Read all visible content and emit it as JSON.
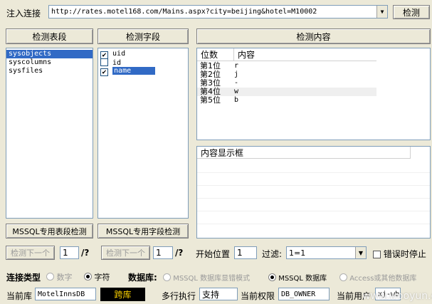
{
  "top": {
    "inject_label": "注入连接",
    "url": "http://rates.motel168.com/Mains.aspx?city=beijing&hotel=M10002",
    "detect_button": "检测"
  },
  "tables_panel": {
    "header": "检测表段",
    "items": [
      "sysobjects",
      "syscolumns",
      "sysfiles"
    ],
    "selected_index": 0,
    "button": "MSSQL专用表段检测"
  },
  "fields_panel": {
    "header": "检测字段",
    "items": [
      {
        "label": "uid",
        "checked": "✔"
      },
      {
        "label": "id",
        "checked": ""
      },
      {
        "label": "name",
        "checked": "✔"
      }
    ],
    "button": "MSSQL专用字段检测"
  },
  "content_panel": {
    "header": "检测内容",
    "columns": [
      "位数",
      "内容"
    ],
    "rows": [
      {
        "pos": "第1位",
        "val": "r"
      },
      {
        "pos": "第2位",
        "val": "j"
      },
      {
        "pos": "第3位",
        "val": "-"
      },
      {
        "pos": "第4位",
        "val": "w"
      },
      {
        "pos": "第5位",
        "val": "b"
      }
    ],
    "display_header": "内容显示框"
  },
  "nav": {
    "next1": "检测下一个",
    "page1": "1",
    "q1": "/?",
    "next2": "检测下一个",
    "page2": "1",
    "q2": "/?",
    "start_label": "开始位置",
    "start_value": "1",
    "filter_label": "过滤:",
    "filter_value": "1=1",
    "stop_on_error": "错误时停止"
  },
  "conn": {
    "type_label": "连接类型",
    "opt_number": "数字",
    "opt_char": "字符",
    "db_label": "数据库:",
    "db_opt1": "MSSQL 数据库显错模式",
    "db_opt2": "MSSQL 数据库",
    "db_opt3": "Access或其他数据库"
  },
  "bottom": {
    "curdb_label": "当前库",
    "curdb_value": "MotelInnsDB",
    "cross_button": "跨库",
    "multi_label": "多行执行",
    "multi_value": "支持",
    "priv_label": "当前权限",
    "priv_value": "DB_OWNER",
    "user_label": "当前用户",
    "user_value": "xj-wb"
  },
  "watermark": "www.wooyun.org"
}
